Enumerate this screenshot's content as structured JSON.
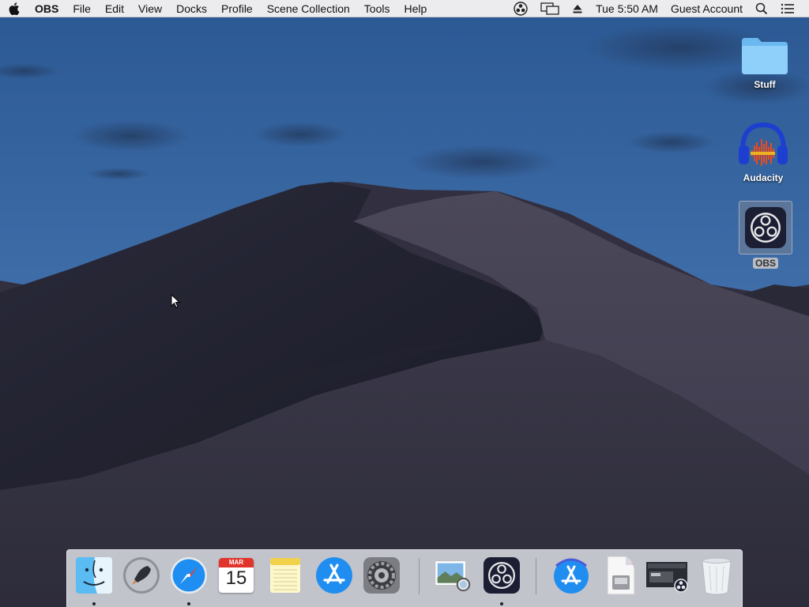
{
  "menubar": {
    "app_name": "OBS",
    "menus": [
      "File",
      "Edit",
      "View",
      "Docks",
      "Profile",
      "Scene Collection",
      "Tools",
      "Help"
    ],
    "clock": "Tue 5:50 AM",
    "user": "Guest Account",
    "status_icons": [
      "obs-status-icon",
      "display-mirroring-icon",
      "eject-icon",
      "spotlight-search-icon",
      "notification-center-icon"
    ]
  },
  "desktop": {
    "icons": [
      {
        "label": "Stuff",
        "icon": "folder-icon",
        "selected": false
      },
      {
        "label": "Audacity",
        "icon": "audacity-icon",
        "selected": false
      },
      {
        "label": "OBS",
        "icon": "obs-icon",
        "selected": true
      }
    ]
  },
  "dock": {
    "items": [
      {
        "name": "Finder",
        "icon": "finder-icon",
        "running": true
      },
      {
        "name": "Launchpad",
        "icon": "launchpad-icon",
        "running": false
      },
      {
        "name": "Safari",
        "icon": "safari-icon",
        "running": true
      },
      {
        "name": "Calendar",
        "icon": "calendar-icon",
        "running": false,
        "month": "MAR",
        "day": "15"
      },
      {
        "name": "Notes",
        "icon": "notes-icon",
        "running": false
      },
      {
        "name": "App Store",
        "icon": "app-store-icon",
        "running": false
      },
      {
        "name": "System Preferences",
        "icon": "system-preferences-icon",
        "running": false
      },
      {
        "name": "Preview",
        "icon": "preview-icon",
        "running": false
      },
      {
        "name": "OBS",
        "icon": "obs-icon",
        "running": true
      },
      {
        "name": "App Store Download",
        "icon": "app-store-download-icon",
        "running": false
      },
      {
        "name": "Document",
        "icon": "document-icon",
        "running": false
      },
      {
        "name": "OBS Recording",
        "icon": "recording-thumbnail-icon",
        "running": false
      },
      {
        "name": "Trash",
        "icon": "trash-icon",
        "running": false
      }
    ]
  },
  "colors": {
    "sky_top": "#2f5c95",
    "sky_bottom": "#4f7fb8",
    "dune_dark": "#1c1d2a",
    "dune_light": "#3e3c4e",
    "menubar_bg": "#ececee",
    "dock_bg": "#d7dae0"
  }
}
